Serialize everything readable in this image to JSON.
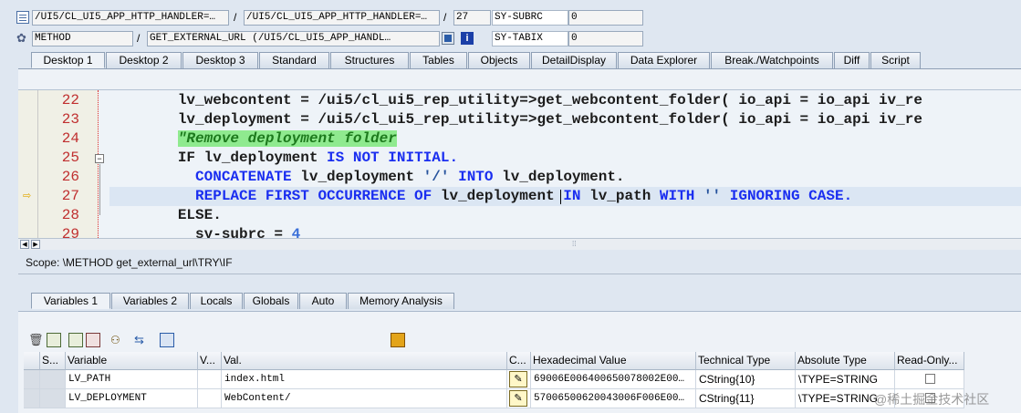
{
  "header": {
    "row1": {
      "field1": "/UI5/CL_UI5_APP_HTTP_HANDLER=…",
      "sep1": "/",
      "field2": "/UI5/CL_UI5_APP_HTTP_HANDLER=…",
      "sep2": "/",
      "line": "27",
      "var_name": "SY-SUBRC",
      "var_value": "0"
    },
    "row2": {
      "kind": "METHOD",
      "sep": "/",
      "method": "GET_EXTERNAL_URL (/UI5/CL_UI5_APP_HANDL…",
      "var_name": "SY-TABIX",
      "var_value": "0"
    }
  },
  "desktop_tabs": [
    "Desktop 1",
    "Desktop 2",
    "Desktop 3",
    "Standard",
    "Structures",
    "Tables",
    "Objects",
    "DetailDisplay",
    "Data Explorer",
    "Break./Watchpoints",
    "Diff",
    "Script"
  ],
  "editor": {
    "lines": [
      {
        "n": "22",
        "parts": [
          [
            "",
            "        lv_webcontent = /ui5/cl_ui5_rep_utility=>get_webcontent_folder( io_api = io_api iv_re"
          ]
        ]
      },
      {
        "n": "23",
        "parts": [
          [
            "",
            "        lv_deployment = /ui5/cl_ui5_rep_utility=>get_webcontent_folder( io_api = io_api iv_re"
          ]
        ]
      },
      {
        "n": "24",
        "parts": [
          [
            "",
            "        "
          ],
          [
            "cm",
            "\"Remove deployment folder"
          ]
        ]
      },
      {
        "n": "25",
        "parts": [
          [
            "",
            "        IF lv_deployment "
          ],
          [
            "kw",
            "IS NOT INITIAL."
          ]
        ]
      },
      {
        "n": "26",
        "parts": [
          [
            "",
            "          "
          ],
          [
            "kw",
            "CONCATENATE"
          ],
          [
            "",
            " lv_deployment "
          ],
          [
            "str",
            "'/'"
          ],
          [
            "",
            " "
          ],
          [
            "kw",
            "INTO"
          ],
          [
            "",
            " lv_deployment."
          ]
        ]
      },
      {
        "n": "27",
        "parts": [
          [
            "",
            "          "
          ],
          [
            "kw",
            "REPLACE FIRST OCCURRENCE OF"
          ],
          [
            "",
            " lv_deployment "
          ],
          [
            "kw",
            "IN"
          ],
          [
            "",
            " lv_path "
          ],
          [
            "kw",
            "WITH"
          ],
          [
            "",
            " "
          ],
          [
            "str",
            "''"
          ],
          [
            "",
            " "
          ],
          [
            "kw",
            "IGNORING CASE."
          ]
        ]
      },
      {
        "n": "28",
        "parts": [
          [
            "",
            "        ELSE."
          ]
        ]
      },
      {
        "n": "29",
        "parts": [
          [
            "",
            "          sy-subrc = "
          ],
          [
            "num",
            "4"
          ]
        ]
      }
    ],
    "current_line": "27"
  },
  "scope": "Scope: \\METHOD get_external_url\\TRY\\IF",
  "variable_tabs": [
    "Variables 1",
    "Variables 2",
    "Locals",
    "Globals",
    "Auto",
    "Memory Analysis"
  ],
  "grid": {
    "columns": [
      "S...",
      "Variable",
      "V...",
      "Val.",
      "C...",
      "Hexadecimal Value",
      "Technical Type",
      "Absolute Type",
      "Read-Only..."
    ],
    "rows": [
      {
        "variable": "LV_PATH",
        "value": "index.html",
        "hex": "69006E006400650078002E00…",
        "tech": "CString{10}",
        "abs": "\\TYPE=STRING"
      },
      {
        "variable": "LV_DEPLOYMENT",
        "value": "WebContent/",
        "hex": "57006500620043006F006E00…",
        "tech": "CString{11}",
        "abs": "\\TYPE=STRING"
      }
    ]
  },
  "watermark": "@稀土掘金技术社区"
}
